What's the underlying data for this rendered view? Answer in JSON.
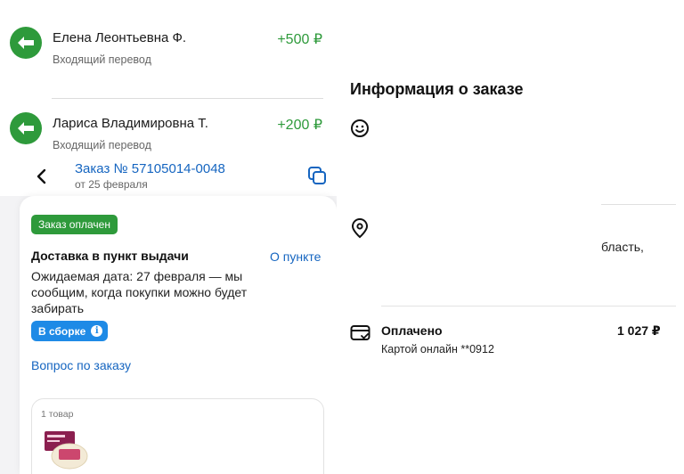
{
  "transfers": [
    {
      "name": "Елена Леонтьевна Ф.",
      "type": "Входящий перевод",
      "amount": "+500 ₽"
    },
    {
      "name": "Лариса Владимировна Т.",
      "type": "Входящий перевод",
      "amount": "+200 ₽"
    }
  ],
  "order": {
    "title": "Заказ № 57105014-0048",
    "date": "от 25 февраля",
    "status_badge": "Заказ оплачен",
    "delivery_title": "Доставка в пункт выдачи",
    "about_link": "О пункте",
    "expected_text": "Ожидаемая дата: 27 февраля — мы сообщим, когда покупки можно будет забирать",
    "assembly_badge": "В сборке",
    "question_link": "Вопрос по заказу",
    "items_count": "1 товар"
  },
  "info": {
    "title": "Информация о заказе",
    "region_text": "бласть,",
    "payment_label": "Оплачено",
    "payment_method": "Картой онлайн **0912",
    "payment_amount": "1 027 ₽"
  },
  "colors": {
    "green": "#2e9a3b",
    "link_blue": "#1565c0",
    "badge_blue": "#1e8ae6"
  }
}
